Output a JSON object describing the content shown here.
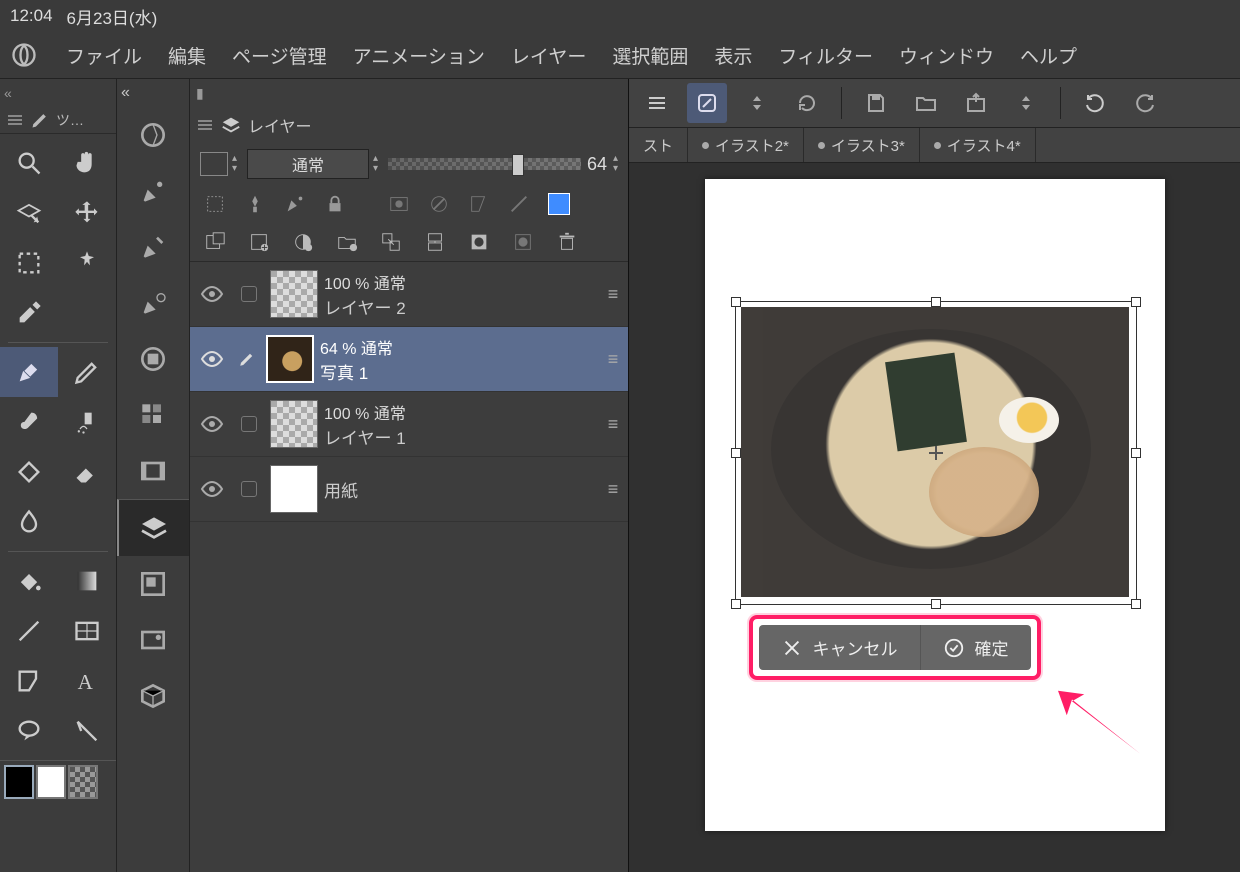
{
  "status": {
    "time": "12:04",
    "date": "6月23日(水)"
  },
  "menu": [
    "ファイル",
    "編集",
    "ページ管理",
    "アニメーション",
    "レイヤー",
    "選択範囲",
    "表示",
    "フィルター",
    "ウィンドウ",
    "ヘルプ"
  ],
  "tool_tab_label": "ツ…",
  "layers_panel": {
    "title": "レイヤー",
    "blend_mode": "通常",
    "opacity_value": "64",
    "opacity_pct": 64,
    "layers": [
      {
        "opacity_label": "100 % 通常",
        "name": "レイヤー 2",
        "thumb": "checker",
        "selected": false
      },
      {
        "opacity_label": "64 % 通常",
        "name": "写真 1",
        "thumb": "photo",
        "selected": true,
        "icon": true
      },
      {
        "opacity_label": "100 % 通常",
        "name": "レイヤー 1",
        "thumb": "checker",
        "selected": false
      },
      {
        "opacity_label": "",
        "name": "用紙",
        "thumb": "white",
        "selected": false,
        "icon": true
      }
    ]
  },
  "doc_tabs": [
    "スト",
    "イラスト2*",
    "イラスト3*",
    "イラスト4*"
  ],
  "confirm": {
    "cancel": "キャンセル",
    "ok": "確定"
  }
}
